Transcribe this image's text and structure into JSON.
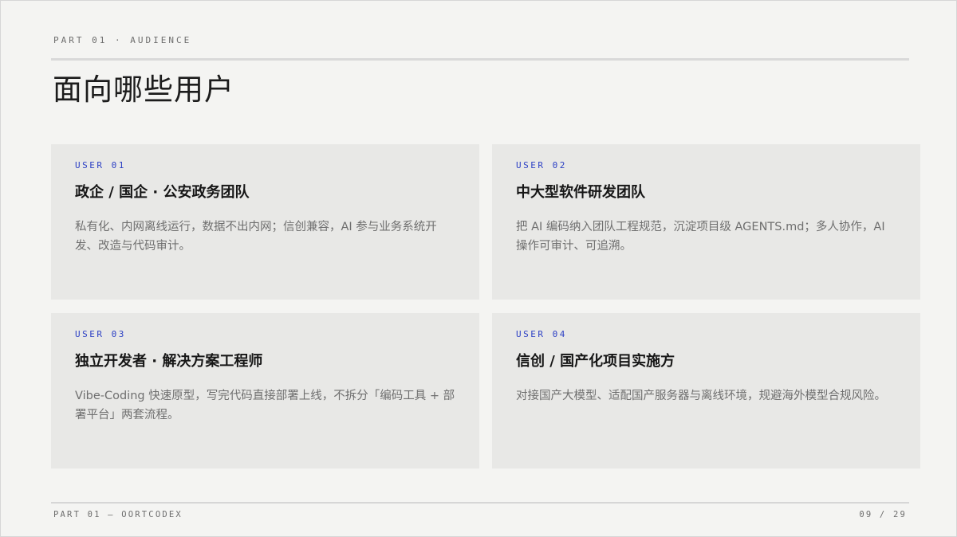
{
  "header": {
    "eyebrow": "PART 01 · AUDIENCE",
    "title": "面向哪些用户"
  },
  "cards": [
    {
      "tag": "USER 01",
      "name": "政企 / 国企 · 公安政务团队",
      "desc": "私有化、内网离线运行，数据不出内网；信创兼容，AI 参与业务系统开发、改造与代码审计。"
    },
    {
      "tag": "USER 02",
      "name": "中大型软件研发团队",
      "desc": "把 AI 编码纳入团队工程规范，沉淀项目级 AGENTS.md；多人协作，AI 操作可审计、可追溯。"
    },
    {
      "tag": "USER 03",
      "name": "独立开发者 · 解决方案工程师",
      "desc": "Vibe-Coding 快速原型，写完代码直接部署上线，不拆分「编码工具 + 部署平台」两套流程。"
    },
    {
      "tag": "USER 04",
      "name": "信创 / 国产化项目实施方",
      "desc": "对接国产大模型、适配国产服务器与离线环境，规避海外模型合规风险。"
    }
  ],
  "footer": {
    "left": "PART 01 — OORTCODEX",
    "right": "09 / 29"
  },
  "colors": {
    "background": "#f4f4f2",
    "card": "#e8e8e6",
    "accent": "#2b3fc4"
  }
}
